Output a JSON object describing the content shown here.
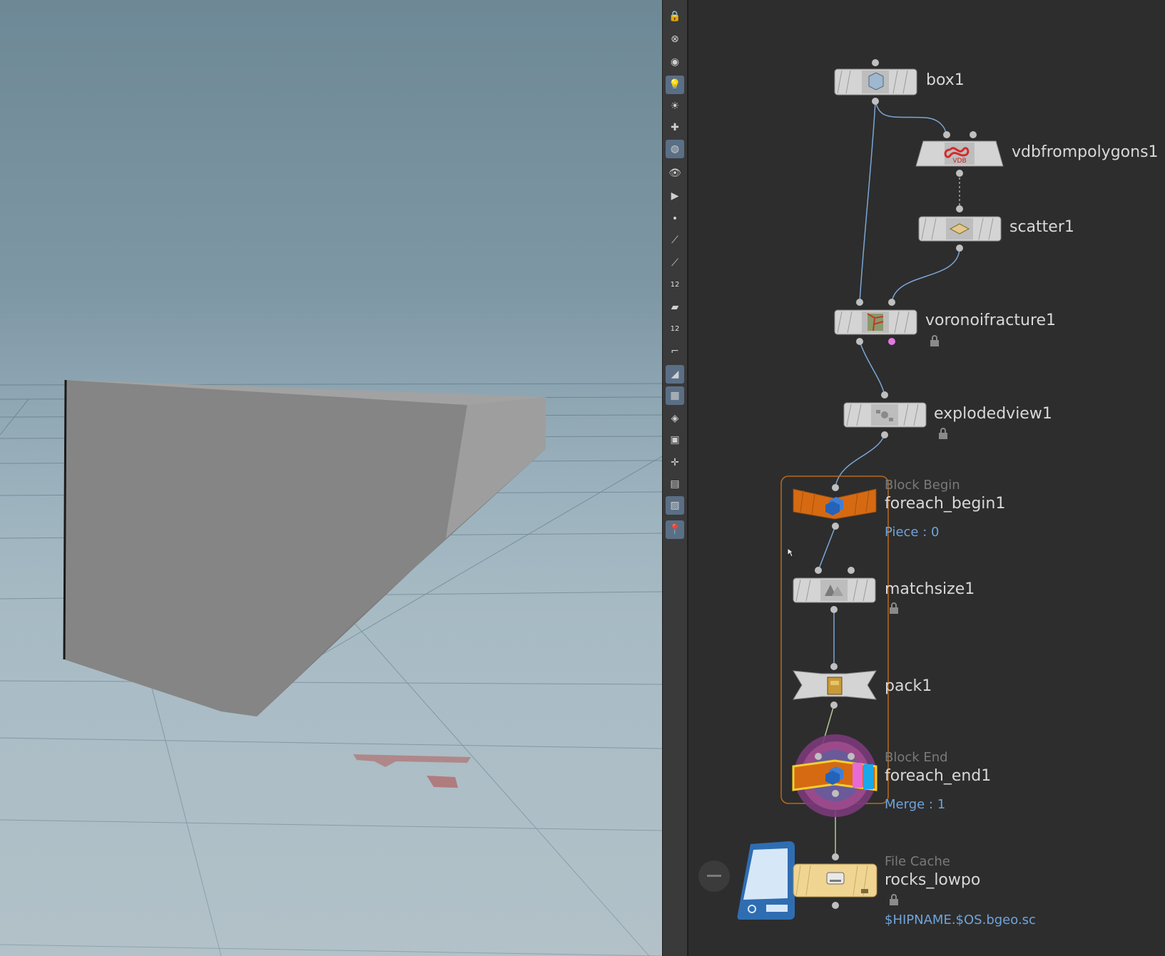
{
  "viewport": {
    "name": "3D Viewport"
  },
  "shelf": {
    "tools": [
      "lock-icon",
      "ghost-icon",
      "camera-menu-icon",
      "headlight-icon",
      "light-icon",
      "light-add-icon",
      "shading-icon",
      "display-options-icon",
      "visualizer-icon",
      "point-icon",
      "normals-icon",
      "vertex-normals-icon",
      "point-numbers-icon",
      "prim-normals-icon",
      "prim-numbers-icon",
      "curve-icon",
      "wireframe-toggle-icon",
      "uv-checker-icon",
      "textures-icon",
      "geometry-icon",
      "handles-icon",
      "grid-icon",
      "background-icon",
      "snap-icon"
    ],
    "point_numbers_badge": "12",
    "prim_numbers_badge": "12"
  },
  "network": {
    "nodes": [
      {
        "id": "box1",
        "label": "box1"
      },
      {
        "id": "vdbfrompolygons1",
        "label": "vdbfrompolygons1",
        "badge": "VDB"
      },
      {
        "id": "scatter1",
        "label": "scatter1"
      },
      {
        "id": "voronoifracture1",
        "label": "voronoifracture1"
      },
      {
        "id": "explodedview1",
        "label": "explodedview1"
      },
      {
        "id": "foreach_begin1",
        "label": "foreach_begin1",
        "type": "Block Begin",
        "info": "Piece : 0"
      },
      {
        "id": "matchsize1",
        "label": "matchsize1"
      },
      {
        "id": "pack1",
        "label": "pack1"
      },
      {
        "id": "foreach_end1",
        "label": "foreach_end1",
        "type": "Block End",
        "info": "Merge : 1"
      },
      {
        "id": "rocks_lowpo",
        "label": "rocks_lowpo",
        "type": "File Cache",
        "info": "$HIPNAME.$OS.bgeo.sc"
      }
    ]
  },
  "colors": {
    "viewport_sky": "#6d8896",
    "node_grey": "#d4d4d4",
    "node_orange": "#d66a12",
    "file_cache_yellow": "#f0d491",
    "wire_blue": "#7aa7d6",
    "info_blue": "#6fa4dc",
    "block_outline": "#b86a1c"
  }
}
